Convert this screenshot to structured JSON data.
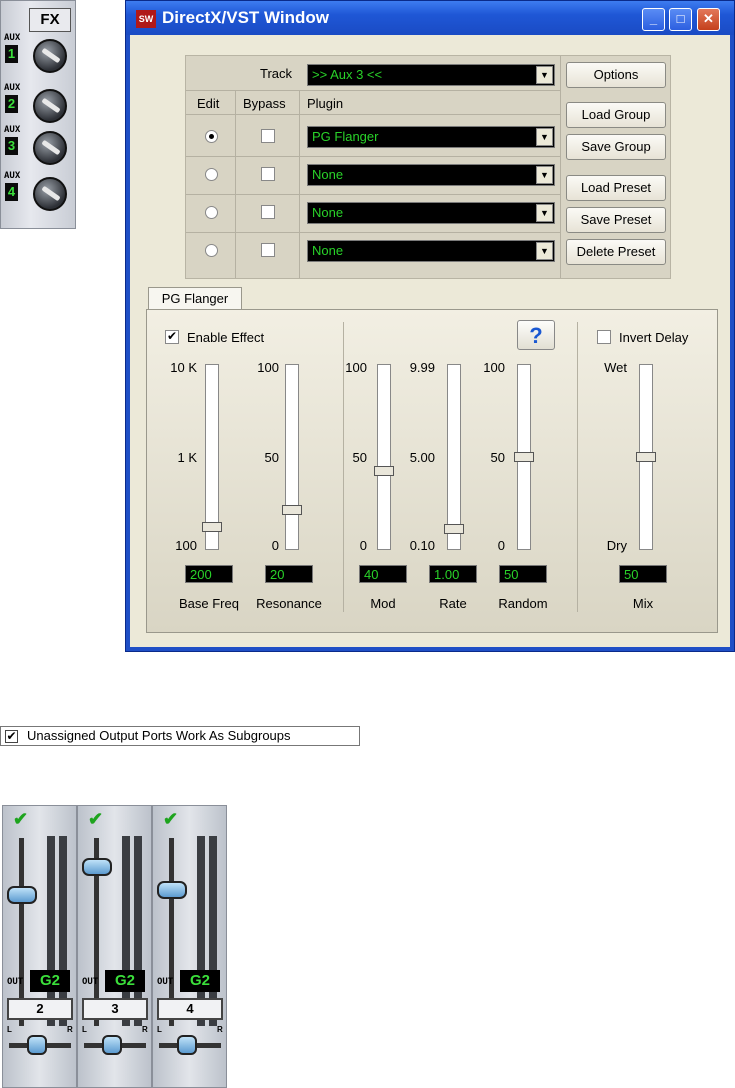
{
  "fx_panel": {
    "label": "FX",
    "aux": [
      {
        "tag": "AUX",
        "num": "1"
      },
      {
        "tag": "AUX",
        "num": "2"
      },
      {
        "tag": "AUX",
        "num": "3"
      },
      {
        "tag": "AUX",
        "num": "4"
      }
    ]
  },
  "window": {
    "title": "DirectX/VST Window",
    "minimize": "_",
    "maximize": "□",
    "close": "✕"
  },
  "track": {
    "label": "Track",
    "value": ">> Aux 3 <<"
  },
  "columns": {
    "edit": "Edit",
    "bypass": "Bypass",
    "plugin": "Plugin"
  },
  "plugins": [
    {
      "value": "PG Flanger",
      "edit_selected": true,
      "bypass": false
    },
    {
      "value": "None",
      "edit_selected": false,
      "bypass": false
    },
    {
      "value": "None",
      "edit_selected": false,
      "bypass": false
    },
    {
      "value": "None",
      "edit_selected": false,
      "bypass": false
    }
  ],
  "buttons": {
    "options": "Options",
    "load_group": "Load Group",
    "save_group": "Save Group",
    "load_preset": "Load Preset",
    "save_preset": "Save Preset",
    "delete_preset": "Delete Preset"
  },
  "tab": {
    "label": "PG Flanger"
  },
  "effect": {
    "enable_label": "Enable Effect",
    "enabled": true,
    "help": "?",
    "invert_label": "Invert Delay",
    "invert": false
  },
  "sliders": {
    "base_freq": {
      "top": "10 K",
      "mid": "1 K",
      "bottom": "100",
      "value": "200",
      "name": "Base Freq",
      "level": 0.1
    },
    "resonance": {
      "top": "100",
      "mid": "50",
      "bottom": "0",
      "value": "20",
      "name": "Resonance",
      "level": 0.2
    },
    "mod": {
      "top": "100",
      "mid": "50",
      "bottom": "0",
      "value": "40",
      "name": "Mod",
      "level": 0.42
    },
    "rate": {
      "top": "9.99",
      "mid": "5.00",
      "bottom": "0.10",
      "value": "1.00",
      "name": "Rate",
      "level": 0.09
    },
    "random": {
      "top": "100",
      "mid": "50",
      "bottom": "0",
      "value": "50",
      "name": "Random",
      "level": 0.5
    },
    "mix": {
      "top": "Wet",
      "bottom": "Dry",
      "value": "50",
      "name": "Mix",
      "level": 0.5
    }
  },
  "subgroup": {
    "label": "Unassigned Output Ports Work As Subgroups",
    "checked": true,
    "mark": "✔"
  },
  "strips": [
    {
      "check": "✔",
      "l": "L",
      "r": "R",
      "out_label": "OUT",
      "out": "G2",
      "number": "2",
      "fader_level": 0.72
    },
    {
      "check": "✔",
      "l": "L",
      "r": "R",
      "out_label": "OUT",
      "out": "G2",
      "number": "3",
      "fader_level": 0.88
    },
    {
      "check": "✔",
      "l": "L",
      "r": "R",
      "out_label": "OUT",
      "out": "G2",
      "number": "4",
      "fader_level": 0.75
    }
  ]
}
